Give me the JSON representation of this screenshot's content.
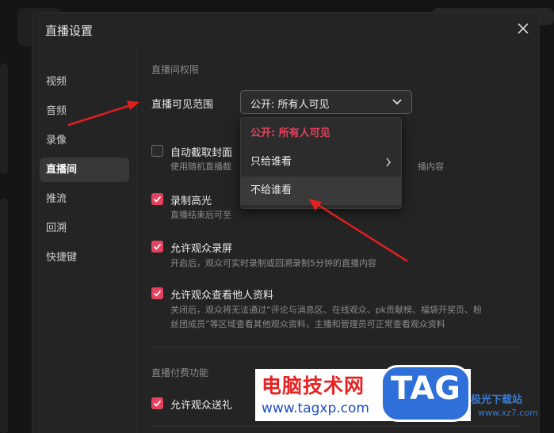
{
  "dialog": {
    "title": "直播设置",
    "close_icon": "close-icon"
  },
  "sidebar": {
    "items": [
      {
        "label": "视频"
      },
      {
        "label": "音频"
      },
      {
        "label": "录像"
      },
      {
        "label": "直播间",
        "active": true
      },
      {
        "label": "推流"
      },
      {
        "label": "回溯"
      },
      {
        "label": "快捷键"
      }
    ]
  },
  "room_permissions": {
    "section_title": "直播间权限",
    "visibility_label": "直播可见范围",
    "visibility_value": "公开: 所有人可见",
    "dropdown_options": [
      {
        "label": "公开: 所有人可见",
        "selected": true
      },
      {
        "label": "只给谁看",
        "has_submenu": true
      },
      {
        "label": "不给谁看",
        "hovered": true
      }
    ],
    "options": [
      {
        "label": "自动截取封面",
        "checked": false,
        "desc_left": "使用随机直播截",
        "desc_right": "播内容"
      },
      {
        "label": "录制高光",
        "checked": true,
        "desc_left": "直播结束后可至"
      },
      {
        "label": "允许观众录屏",
        "checked": true,
        "desc": "开启后，观众可实时录制或回溯录制5分钟的直播内容"
      },
      {
        "label": "允许观众查看他人资料",
        "checked": true,
        "desc_line1": "关闭后，观众将无法通过“评论与消息区、在线观众、pk贡献榜、福袋开奖页、粉",
        "desc_line2": "丝团成员”等区域查看其他观众资料，主播和管理员可正常查看观众资料"
      }
    ]
  },
  "paid_features": {
    "section_title": "直播付费功能",
    "options": [
      {
        "label": "允许观众送礼",
        "checked": true
      }
    ]
  },
  "watermark": {
    "site_name": "电脑技术网",
    "site_url": "www.tagxp.com",
    "badge": "TAG",
    "corner_text": "极光下载站",
    "corner_url": "www.xz7.com"
  },
  "colors": {
    "accent": "#e5435d",
    "annotation_arrow": "#e02020"
  }
}
